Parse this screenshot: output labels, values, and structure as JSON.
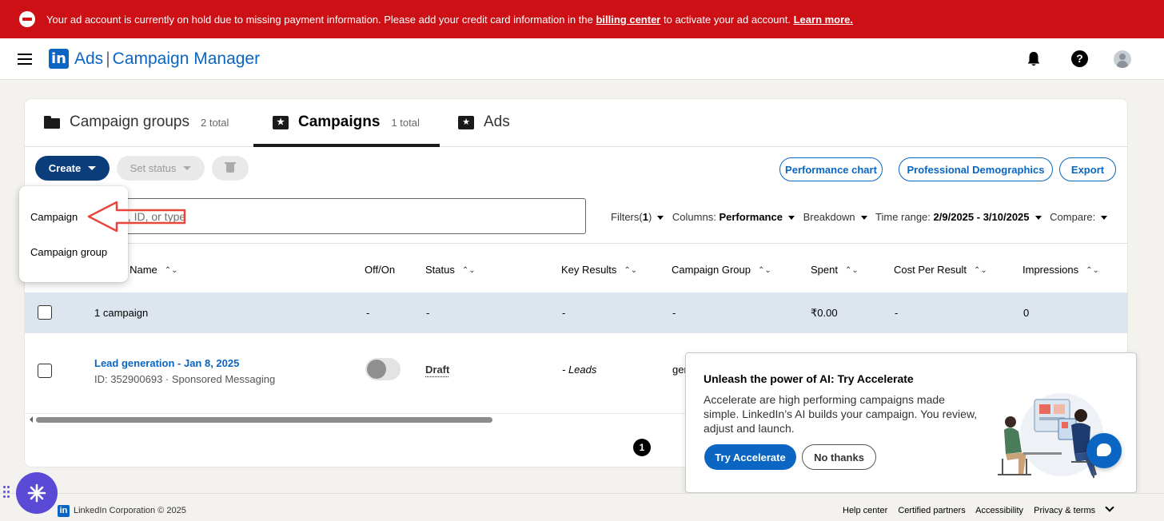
{
  "banner": {
    "message_pre": "Your ad account is currently on hold due to missing payment information. Please add your credit card information in the",
    "billing_link": "billing center",
    "message_post": "to activate your ad account.",
    "learn_more": "Learn more."
  },
  "header": {
    "logo": "in",
    "product": "Ads",
    "separator": "|",
    "title": "Campaign Manager",
    "help_glyph": "?"
  },
  "tabs": [
    {
      "label": "Campaign groups",
      "count": "2 total",
      "icon": "folder-icon"
    },
    {
      "label": "Campaigns",
      "count": "1 total",
      "icon": "campaign-icon",
      "active": true
    },
    {
      "label": "Ads",
      "count": "",
      "icon": "ads-icon"
    }
  ],
  "toolbar": {
    "create_label": "Create",
    "set_status_label": "Set status",
    "performance_chart": "Performance chart",
    "professional_demographics": "Professional Demographics",
    "export": "Export"
  },
  "create_menu": {
    "items": [
      "Campaign",
      "Campaign group"
    ]
  },
  "search": {
    "visible_text": "e, ID, or type"
  },
  "filter_bar": {
    "filters_label": "Filters(",
    "filters_count": "1",
    "filters_close": ")",
    "columns_label": "Columns:",
    "columns_value": "Performance",
    "breakdown_label": "Breakdown",
    "time_range_label": "Time range:",
    "time_range_value": "2/9/2025 - 3/10/2025",
    "compare_label": "Compare:"
  },
  "table": {
    "columns": [
      "gn Name",
      "Off/On",
      "Status",
      "Key Results",
      "Campaign Group",
      "Spent",
      "Cost Per Result",
      "Impressions"
    ],
    "summary": {
      "label": "1 campaign",
      "off_on": "-",
      "status": "-",
      "key_results": "-",
      "campaign_group": "-",
      "spent": "₹0.00",
      "cost_per_result": "-",
      "impressions": "0"
    },
    "rows": [
      {
        "name": "Lead generation - Jan 8, 2025",
        "meta": "ID: 352900693 · Sponsored Messaging",
        "status": "Draft",
        "key_results": "- Leads",
        "campaign_group_partial": "ger"
      }
    ]
  },
  "pagination": {
    "current": "1"
  },
  "accelerate_popup": {
    "title": "Unleash the power of AI: Try Accelerate",
    "body": "Accelerate are high performing campaigns made simple. LinkedIn’s AI builds your campaign. You review, adjust and launch.",
    "try_label": "Try Accelerate",
    "dismiss_label": "No thanks"
  },
  "footer": {
    "logo": "in",
    "copyright": "LinkedIn Corporation © 2025",
    "links": [
      "Help center",
      "Certified partners",
      "Accessibility",
      "Privacy & terms"
    ]
  },
  "colors": {
    "banner_bg": "#cc1016",
    "brand_blue": "#0a66c2",
    "create_button": "#0a3d7a",
    "summary_row": "#dde6ee",
    "annotation_arrow": "#e8453c",
    "assistant_fab": "#5b4ad6"
  }
}
